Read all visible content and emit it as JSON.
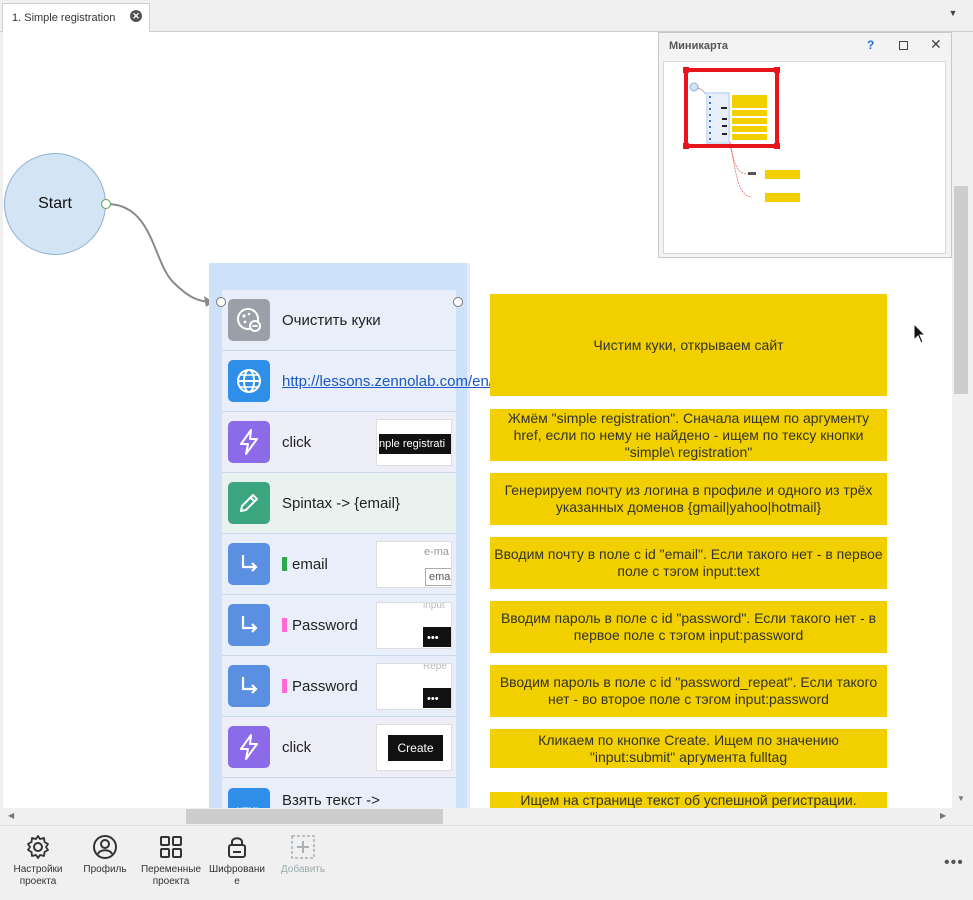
{
  "tab": {
    "title": "1. Simple registration"
  },
  "start_node": {
    "label": "Start"
  },
  "group_actions": [
    {
      "icon": "cookie-icon",
      "label": "Очистить куки",
      "bar_color": ""
    },
    {
      "icon": "globe-icon",
      "label": "http://lessons.zennolab.com/en/index",
      "bar_color": ""
    },
    {
      "icon": "lightning-icon",
      "label": "click",
      "bar_color": "",
      "thumb": "nple registrati"
    },
    {
      "icon": "pencil-icon",
      "label": "Spintax -> {email}",
      "bar_color": ""
    },
    {
      "icon": "arrow-right-icon",
      "label": "email",
      "bar_color": "#2ca84f",
      "thumb_top": "e-ma",
      "thumb_bottom": "ema"
    },
    {
      "icon": "arrow-right-icon",
      "label": "Password",
      "bar_color": "#ff6ad5",
      "thumb_top": "input",
      "thumb_bottom": "•••"
    },
    {
      "icon": "arrow-right-icon",
      "label": "Password",
      "bar_color": "#ff6ad5",
      "thumb_top": "Repe",
      "thumb_bottom": "•••"
    },
    {
      "icon": "lightning-icon",
      "label": "click",
      "bar_color": "",
      "thumb": "Create"
    },
    {
      "icon": "html-icon",
      "label": "Взять текст ->",
      "bar_color": ""
    }
  ],
  "notes": [
    "Чистим куки, открываем сайт",
    "Жмём \"simple registration\". Сначала ищем по аргументу href, если по нему не найдено - ищем по тексу кнопки \"simple\\ registration\"",
    "Генерируем почту из логина в профиле и одного из трёх указанных доменов {gmail|yahoo|hotmail}",
    "Вводим почту в поле с id \"email\". Если такого нет - в первое поле с тэгом input:text",
    "Вводим пароль в поле с id \"password\". Если такого нет - в первое поле с тэгом input:password",
    "Вводим пароль в поле с id \"password_repeat\". Если такого нет - во второе поле с тэгом input:password",
    "Кликаем по кнопке Create. Ищем по значению \"input:submit\" аргумента fulltag",
    "Ищем на странице текст об успешной регистрации."
  ],
  "minimap": {
    "title": "Миникарта",
    "help": "?"
  },
  "toolbar": {
    "settings": "Настройки проекта",
    "profile": "Профиль",
    "variables": "Переменные проекта",
    "encryption": "Шифровани е",
    "add": "Добавить"
  },
  "colors": {
    "note": "#f2d000",
    "group": "#cde2f8",
    "start": "#d3e4f4",
    "minimap_frame": "#e8141c"
  }
}
